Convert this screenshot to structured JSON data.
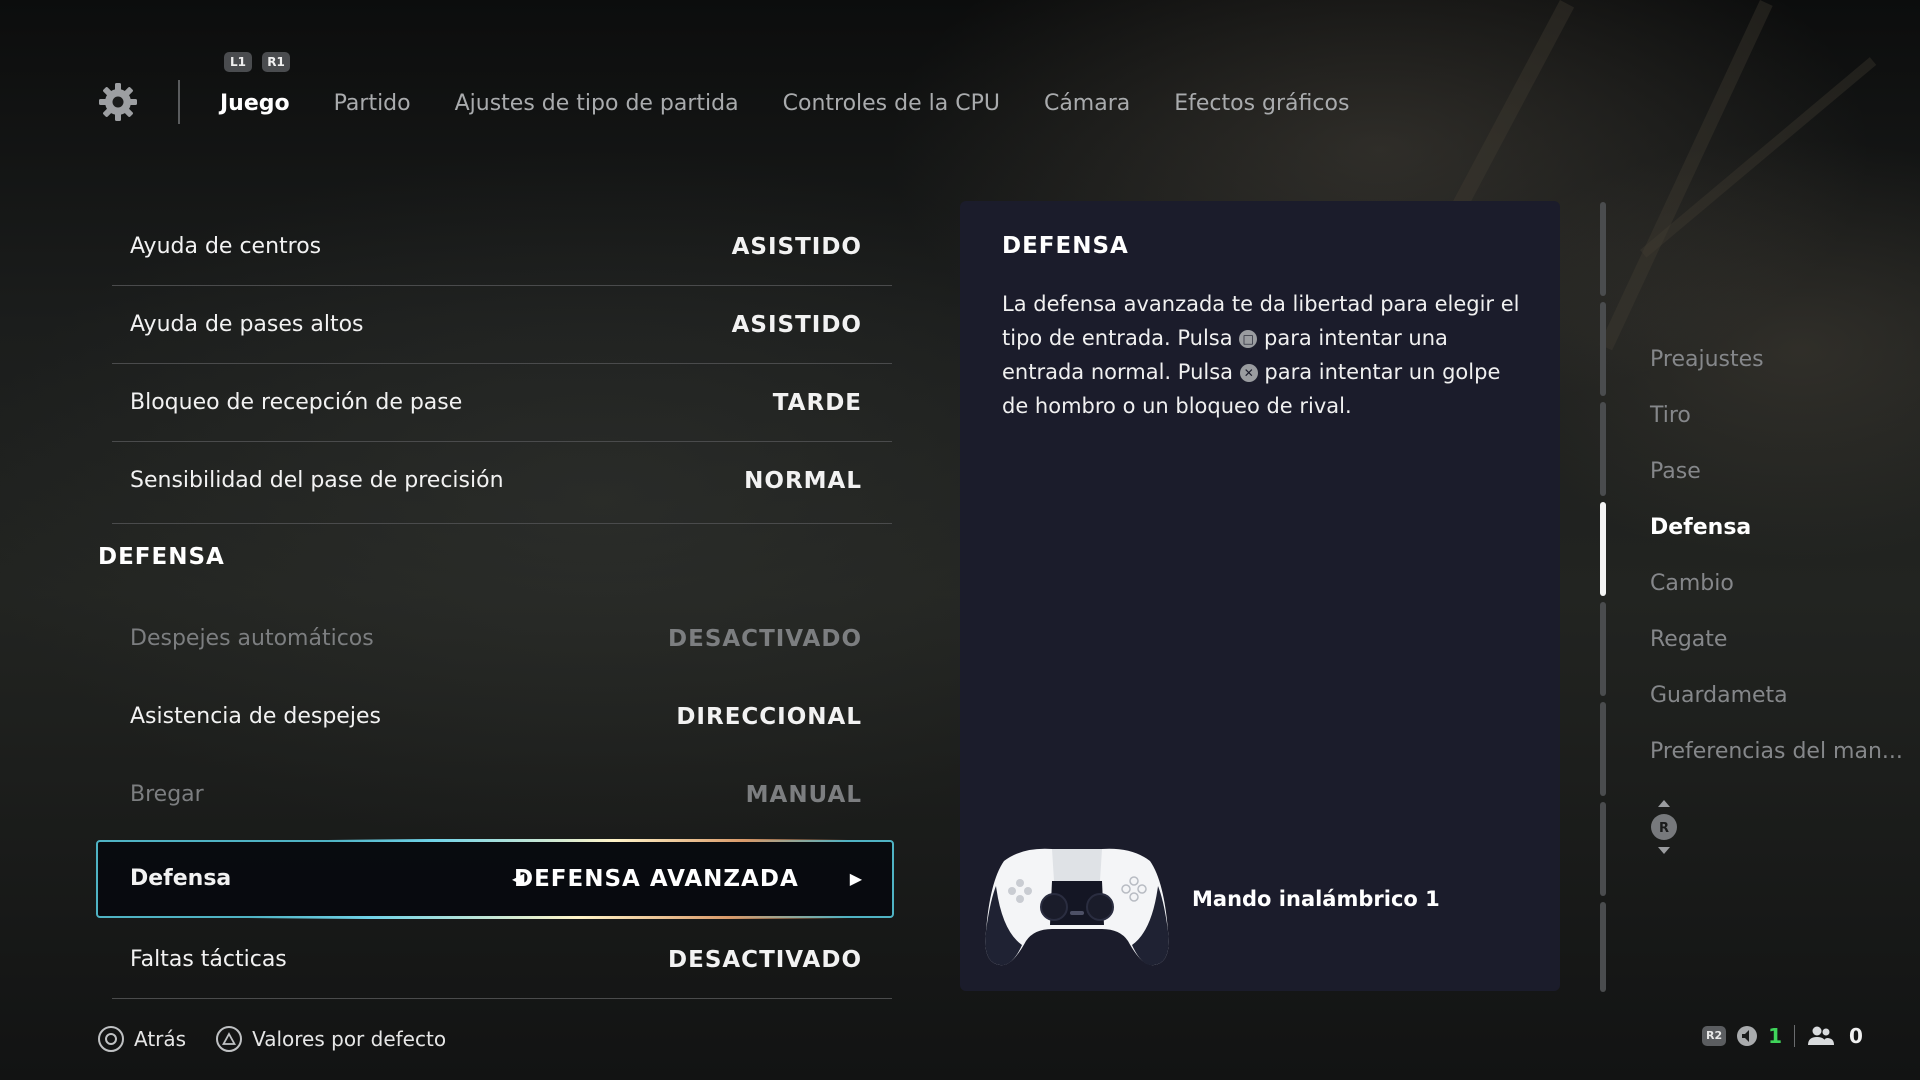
{
  "nav": {
    "shoulder_left": "L1",
    "shoulder_right": "R1",
    "tabs": [
      {
        "label": "Juego",
        "active": true
      },
      {
        "label": "Partido",
        "active": false
      },
      {
        "label": "Ajustes de tipo de partida",
        "active": false
      },
      {
        "label": "Controles de la CPU",
        "active": false
      },
      {
        "label": "Cámara",
        "active": false
      },
      {
        "label": "Efectos gráficos",
        "active": false
      }
    ]
  },
  "settings": {
    "rows_top": [
      {
        "label": "Ayuda de centros",
        "value": "ASISTIDO",
        "enabled": true
      },
      {
        "label": "Ayuda de pases altos",
        "value": "ASISTIDO",
        "enabled": true
      },
      {
        "label": "Bloqueo de recepción de pase",
        "value": "TARDE",
        "enabled": true
      },
      {
        "label": "Sensibilidad del pase de precisión",
        "value": "NORMAL",
        "enabled": true
      }
    ],
    "section_title": "DEFENSA",
    "rows_defense": [
      {
        "label": "Despejes automáticos",
        "value": "DESACTIVADO",
        "enabled": false
      },
      {
        "label": "Asistencia de despejes",
        "value": "DIRECCIONAL",
        "enabled": true
      },
      {
        "label": "Bregar",
        "value": "MANUAL",
        "enabled": false
      }
    ],
    "selected": {
      "label": "Defensa",
      "value": "DEFENSA AVANZADA"
    },
    "rows_bottom": [
      {
        "label": "Faltas tácticas",
        "value": "DESACTIVADO",
        "enabled": true
      }
    ]
  },
  "info_panel": {
    "title": "DEFENSA",
    "desc_1": "La defensa avanzada te da libertad para elegir el tipo de entrada. Pulsa",
    "desc_2": "para intentar una entrada normal. Pulsa",
    "desc_3": "para intentar un golpe de hombro o un bloqueo de rival.",
    "controller_name": "Mando inalámbrico 1"
  },
  "categories": [
    {
      "label": "Preajustes",
      "active": false
    },
    {
      "label": "Tiro",
      "active": false
    },
    {
      "label": "Pase",
      "active": false
    },
    {
      "label": "Defensa",
      "active": true
    },
    {
      "label": "Cambio",
      "active": false
    },
    {
      "label": "Regate",
      "active": false
    },
    {
      "label": "Guardameta",
      "active": false
    },
    {
      "label": "Preferencias del man...",
      "active": false
    }
  ],
  "rstick_label": "R",
  "footer": {
    "back_label": "Atrás",
    "defaults_label": "Valores por defecto"
  },
  "status": {
    "r2_label": "R2",
    "count_one": "1",
    "count_two": "0",
    "count_one_color": "#3fd45a"
  },
  "colors": {
    "accent_border": "#4fb3c4",
    "panel_bg": "#1b1c2b"
  }
}
